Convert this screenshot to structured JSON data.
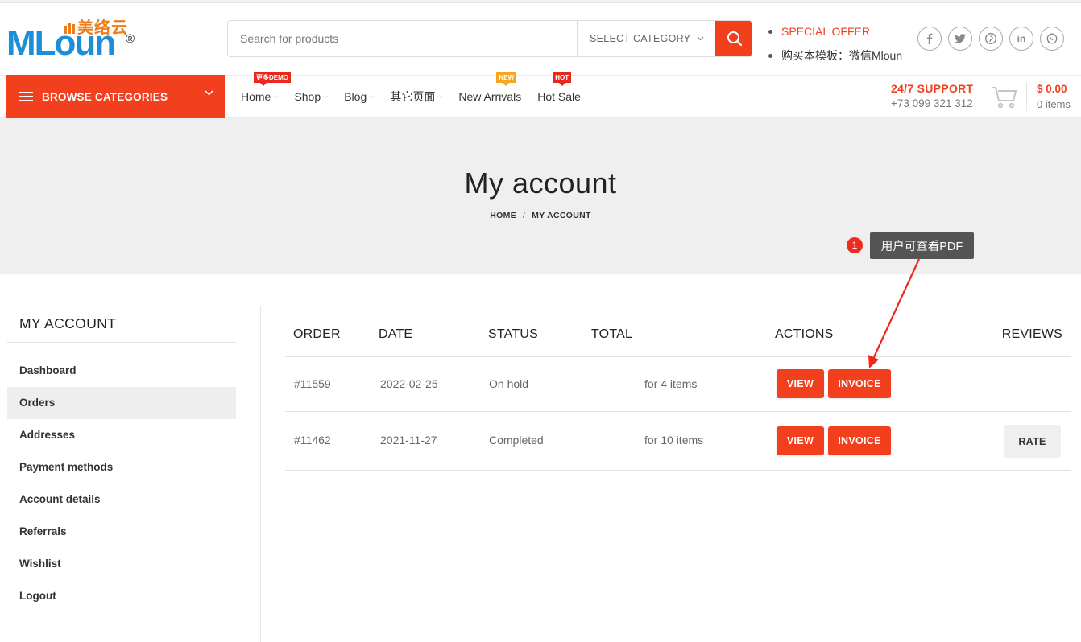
{
  "brand": {
    "logo_latin": "MLoun",
    "logo_cn": "美络云",
    "logo_reg": "®"
  },
  "search": {
    "placeholder": "Search for products",
    "category_label": "SELECT CATEGORY"
  },
  "promo": {
    "special_offer": "SPECIAL OFFER",
    "buy_template": "购买本模板：微信Mloun"
  },
  "social": [
    "f",
    "t",
    "p",
    "in",
    "w"
  ],
  "nav": {
    "browse_label": "BROWSE CATEGORIES",
    "items": [
      {
        "label": "Home",
        "badge": "更多DEMO"
      },
      {
        "label": "Shop",
        "badge": ""
      },
      {
        "label": "Blog",
        "badge": ""
      },
      {
        "label": "其它页面",
        "badge": ""
      },
      {
        "label": "New Arrivals",
        "badge": "NEW"
      },
      {
        "label": "Hot Sale",
        "badge": "HOT"
      }
    ]
  },
  "support": {
    "title": "24/7 SUPPORT",
    "phone": "+73 099 321 312"
  },
  "cart": {
    "price": "$ 0.00",
    "items": "0 items"
  },
  "page": {
    "title": "My account",
    "breadcrumb_home": "HOME",
    "breadcrumb_sep": "/",
    "breadcrumb_current": "MY ACCOUNT"
  },
  "sidebar": {
    "heading": "MY ACCOUNT",
    "items": [
      {
        "label": "Dashboard",
        "active": false
      },
      {
        "label": "Orders",
        "active": true
      },
      {
        "label": "Addresses",
        "active": false
      },
      {
        "label": "Payment methods",
        "active": false
      },
      {
        "label": "Account details",
        "active": false
      },
      {
        "label": "Referrals",
        "active": false
      },
      {
        "label": "Wishlist",
        "active": false
      },
      {
        "label": "Logout",
        "active": false
      }
    ]
  },
  "orders": {
    "headers": {
      "order": "ORDER",
      "date": "DATE",
      "status": "STATUS",
      "total": "TOTAL",
      "actions": "ACTIONS",
      "reviews": "REVIEWS"
    },
    "rows": [
      {
        "order": "#11559",
        "date": "2022-02-25",
        "status": "On hold",
        "total": "for 4 items",
        "view": "VIEW",
        "invoice": "INVOICE",
        "rate": ""
      },
      {
        "order": "#11462",
        "date": "2021-11-27",
        "status": "Completed",
        "total": "for 10 items",
        "view": "VIEW",
        "invoice": "INVOICE",
        "rate": "RATE"
      }
    ]
  },
  "annotation": {
    "number": "1",
    "text": "用户可查看PDF"
  },
  "colors": {
    "accent": "#f2401f",
    "logo_blue": "#1e8fd6",
    "logo_orange": "#ef7d1a",
    "badge_new": "#f6a623",
    "tooltip_bg": "#555555"
  }
}
